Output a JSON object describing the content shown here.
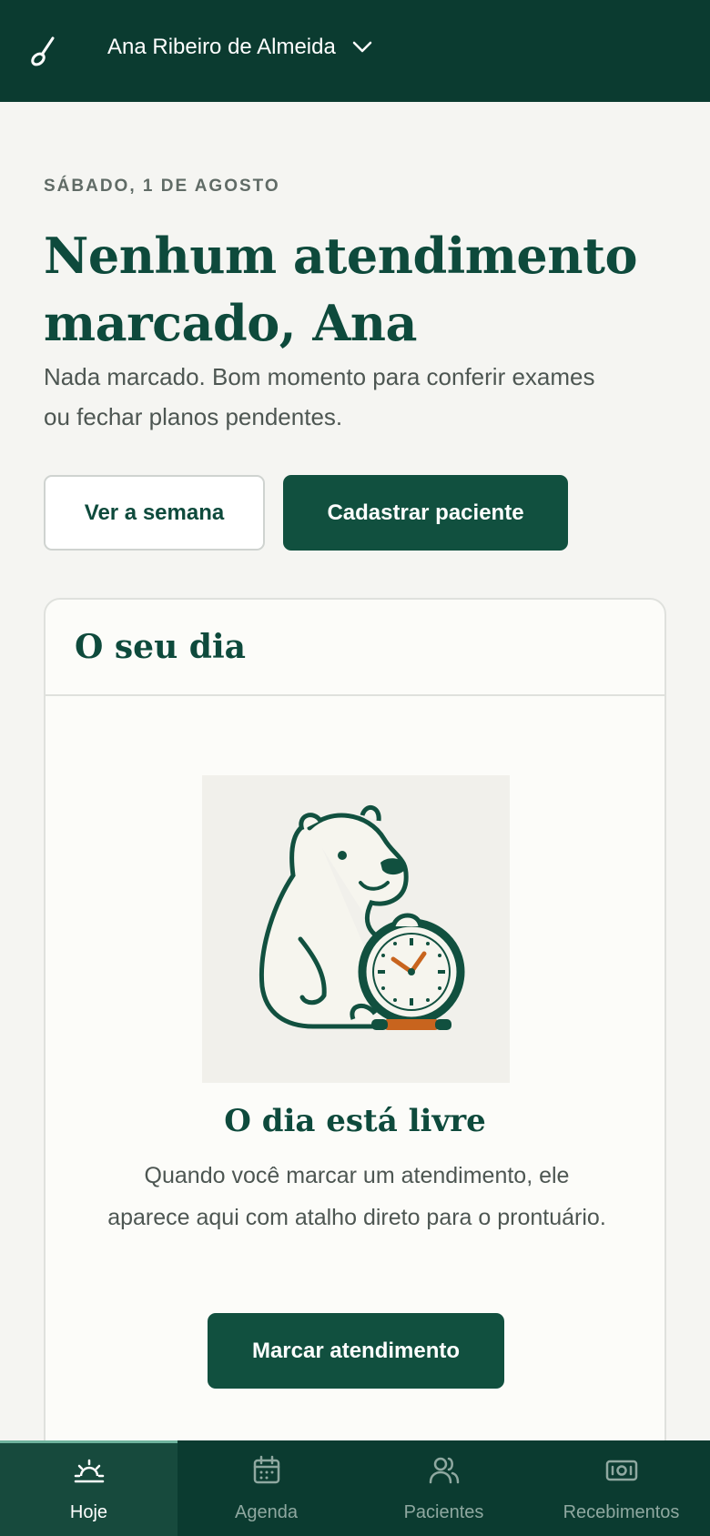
{
  "header": {
    "user_name": "Ana Ribeiro de Almeida",
    "logo_icon": "spoon-leaf-icon",
    "dropdown_icon": "chevron-down-icon"
  },
  "main": {
    "date": "SÁBADO, 1 DE AGOSTO",
    "headline": "Nenhum atendimento marcado, Ana",
    "subtext": "Nada marcado. Bom momento para conferir exames ou fechar planos pendentes.",
    "week_button": "Ver a semana",
    "register_button": "Cadastrar paciente"
  },
  "day_card": {
    "title": "O seu dia",
    "illustration_icon": "capybara-clock-illustration",
    "empty_title": "O dia está livre",
    "empty_text": "Quando você marcar um atendimento, ele aparece aqui com atalho direto para o prontuário.",
    "book_button": "Marcar atendimento"
  },
  "tabbar": {
    "items": [
      {
        "label": "Hoje",
        "icon": "sunrise-icon",
        "active": true
      },
      {
        "label": "Agenda",
        "icon": "calendar-icon",
        "active": false
      },
      {
        "label": "Pacientes",
        "icon": "users-icon",
        "active": false
      },
      {
        "label": "Recebimentos",
        "icon": "banknote-icon",
        "active": false
      }
    ]
  },
  "colors": {
    "brand_dark": "#0b3b30",
    "brand_primary": "#11503f",
    "accent_orange": "#c8641e",
    "background": "#f5f5f2"
  }
}
